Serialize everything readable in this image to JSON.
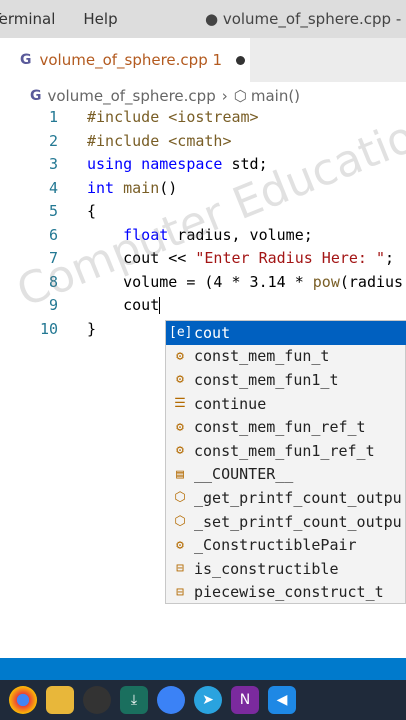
{
  "menubar": {
    "terminal": "Terminal",
    "help": "Help",
    "window_title": "● volume_of_sphere.cpp - Youtube"
  },
  "tab": {
    "label": "volume_of_sphere.cpp 1"
  },
  "breadcrumb": {
    "file": "volume_of_sphere.cpp",
    "symbol": "main()"
  },
  "code_lines": [
    {
      "n": "1",
      "html": "<span class='pp'>#include &lt;iostream&gt;</span>"
    },
    {
      "n": "2",
      "html": "<span class='pp'>#include &lt;cmath&gt;</span>"
    },
    {
      "n": "3",
      "html": "<span class='kw'>using namespace</span> std;"
    },
    {
      "n": "4",
      "html": "<span class='ty'>int</span> <span class='fn'>main</span>()"
    },
    {
      "n": "5",
      "html": "{"
    },
    {
      "n": "6",
      "html": "    <span class='ty'>float</span> radius, volume;"
    },
    {
      "n": "7",
      "html": "    cout &lt;&lt; <span class='str'>\"Enter Radius Here: \"</span>;"
    },
    {
      "n": "8",
      "html": "    volume = (4 * 3.14 * <span class='fn'>pow</span>(radius"
    },
    {
      "n": "9",
      "html": "    cout"
    },
    {
      "n": "10",
      "html": "}"
    }
  ],
  "suggestions": [
    {
      "label": "cout",
      "icon": "variable-icon",
      "glyph": "[e]",
      "selected": true
    },
    {
      "label": "const_mem_fun_t",
      "icon": "class-icon",
      "glyph": "⚙",
      "selected": false
    },
    {
      "label": "const_mem_fun1_t",
      "icon": "class-icon",
      "glyph": "⚙",
      "selected": false
    },
    {
      "label": "continue",
      "icon": "keyword-icon",
      "glyph": "☰",
      "selected": false
    },
    {
      "label": "const_mem_fun_ref_t",
      "icon": "class-icon",
      "glyph": "⚙",
      "selected": false
    },
    {
      "label": "const_mem_fun1_ref_t",
      "icon": "class-icon",
      "glyph": "⚙",
      "selected": false
    },
    {
      "label": "__COUNTER__",
      "icon": "macro-icon",
      "glyph": "▤",
      "selected": false
    },
    {
      "label": "_get_printf_count_outpu",
      "icon": "function-icon",
      "glyph": "⬡",
      "selected": false
    },
    {
      "label": "_set_printf_count_outpu",
      "icon": "function-icon",
      "glyph": "⬡",
      "selected": false
    },
    {
      "label": "_ConstructiblePair",
      "icon": "class-icon",
      "glyph": "⚙",
      "selected": false
    },
    {
      "label": "is_constructible",
      "icon": "struct-icon",
      "glyph": "⊟",
      "selected": false
    },
    {
      "label": "piecewise_construct_t",
      "icon": "struct-icon",
      "glyph": "⊟",
      "selected": false
    }
  ],
  "watermark": "Computer Education",
  "colors": {
    "accent": "#0060c0",
    "status": "#007acc",
    "taskbar": "#1f2a3a"
  }
}
